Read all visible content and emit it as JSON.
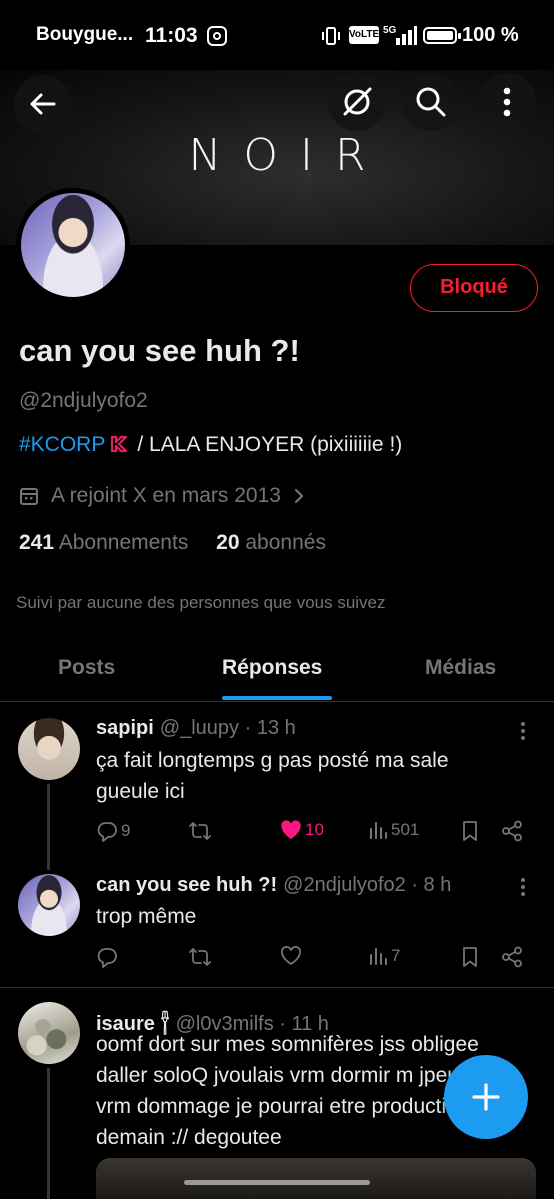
{
  "status_bar": {
    "carrier": "Bouygue...",
    "time": "11:03",
    "network_badge": "VoLTE",
    "network_type": "5G",
    "battery": "100 %"
  },
  "header": {
    "banner_text": "NOIR",
    "icons": [
      "back-arrow-icon",
      "grok-icon",
      "search-icon",
      "more-vertical-icon"
    ]
  },
  "profile": {
    "display_name": "can you see huh ?!",
    "handle": "@2ndjulyofo2",
    "bio_tag": "#KCORP",
    "bio_rest": "/ LALA ENJOYER (pixiiiiiie !)",
    "joined": "A rejoint X en mars 2013",
    "following_count": "241",
    "following_label": "Abonnements",
    "followers_count": "20",
    "followers_label": "abonnés",
    "followed_by": "Suivi par aucune des personnes que vous suivez",
    "blocked_label": "Bloqué"
  },
  "tabs": [
    {
      "label": "Posts",
      "active": false
    },
    {
      "label": "Réponses",
      "active": true
    },
    {
      "label": "Médias",
      "active": false
    }
  ],
  "tweets": [
    {
      "name": "sapipi",
      "handle": "@_luupy",
      "time": "· 13 h",
      "text": "ça fait longtemps g pas posté ma sale gueule ici",
      "replies": "9",
      "retweets": "",
      "likes": "10",
      "liked": true,
      "views": "501"
    },
    {
      "name": "can you see huh ?!",
      "handle": "@2ndjulyofo2",
      "time": "· 8 h",
      "text": "trop même",
      "replies": "",
      "retweets": "",
      "likes": "",
      "liked": false,
      "views": "7"
    },
    {
      "name": "isaure 𓋃",
      "handle": "@l0v3milfs",
      "time": "· 11 h",
      "text": "oomf dort sur mes somnifères jss obligee daller soloQ jvoulais vrm dormir m jpeux pas vrm dommage je pourrai etre productive demain :// degoutee"
    }
  ],
  "colors": {
    "accent": "#1d9bf0",
    "like": "#f91880",
    "blocked": "#f4212e",
    "muted": "#71767b"
  }
}
